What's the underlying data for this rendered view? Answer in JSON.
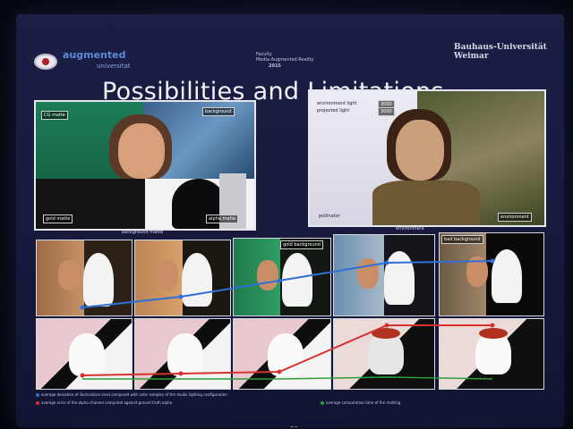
{
  "header": {
    "logo_text": "augmented",
    "logo_sub": "universitat",
    "center_line1": "Faculty",
    "center_line2": "Media Augmented Reality",
    "page_label": "2015",
    "university": "Bauhaus-Universität",
    "city": "Weimar"
  },
  "slide": {
    "title": "Possibilities and Limitations",
    "page_number": "30"
  },
  "left_panel": {
    "tag_top_left": "CG matte",
    "tag_top_right": "background",
    "tag_bottom_left": "gold matte",
    "tag_bottom_right": "alpha matte",
    "caption": "background matte"
  },
  "right_panel": {
    "tag_top": "environment light",
    "tag_top2": "projected light",
    "tag_box1": "3000",
    "tag_box2": "3000",
    "tag_bottom_left": "pollinator",
    "tag_bottom_right": "environment",
    "caption": "environment"
  },
  "grid": {
    "top_tags": [
      "",
      "",
      "gold background",
      "",
      "bad background"
    ]
  },
  "legend": {
    "line1": "average deviation of illumination level compared with color samples of the studio lighting configuration",
    "line2": "average error of the alpha channel computed against ground truth alpha",
    "line3": "average computation time of the matting"
  },
  "colors": {
    "blue_series": "#2f6fd6",
    "red_series": "#d6312f",
    "green_series": "#2f9d3a"
  }
}
